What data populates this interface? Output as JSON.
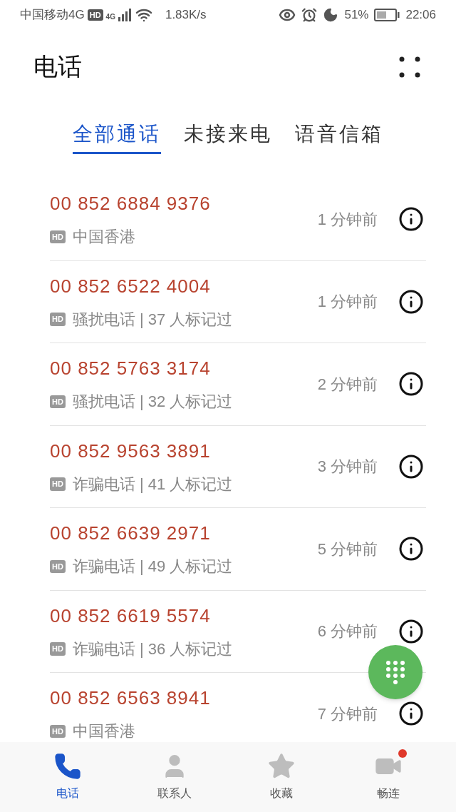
{
  "status_bar": {
    "carrier": "中国移动4G",
    "hd": "HD",
    "network": "4G",
    "speed": "1.83K/s",
    "battery": "51%",
    "time": "22:06"
  },
  "header": {
    "title": "电话"
  },
  "tabs": [
    {
      "label": "全部通话",
      "selected": true
    },
    {
      "label": "未接来电",
      "selected": false
    },
    {
      "label": "语音信箱",
      "selected": false
    }
  ],
  "calls": [
    {
      "number": "00 852 6884 9376",
      "hd": "HD",
      "info": "中国香港",
      "time": "1 分钟前",
      "missed": true
    },
    {
      "number": "00 852 6522 4004",
      "hd": "HD",
      "info": "骚扰电话 | 37 人标记过",
      "time": "1 分钟前",
      "missed": true
    },
    {
      "number": "00 852 5763 3174",
      "hd": "HD",
      "info": "骚扰电话 | 32 人标记过",
      "time": "2 分钟前",
      "missed": true
    },
    {
      "number": "00 852 9563 3891",
      "hd": "HD",
      "info": "诈骗电话 | 41 人标记过",
      "time": "3 分钟前",
      "missed": true
    },
    {
      "number": "00 852 6639 2971",
      "hd": "HD",
      "info": "诈骗电话 | 49 人标记过",
      "time": "5 分钟前",
      "missed": true
    },
    {
      "number": "00 852 6619 5574",
      "hd": "HD",
      "info": "诈骗电话 | 36 人标记过",
      "time": "6 分钟前",
      "missed": true
    },
    {
      "number": "00 852 6563 8941",
      "hd": "HD",
      "info": "中国香港",
      "time": "7 分钟前",
      "missed": true
    }
  ],
  "bottom_nav": [
    {
      "kind": "phone",
      "label": "电话",
      "selected": true,
      "notification": false
    },
    {
      "kind": "contacts",
      "label": "联系人",
      "selected": false,
      "notification": false
    },
    {
      "kind": "favorites",
      "label": "收藏",
      "selected": false,
      "notification": false
    },
    {
      "kind": "meetime",
      "label": "畅连",
      "selected": false,
      "notification": true
    }
  ]
}
